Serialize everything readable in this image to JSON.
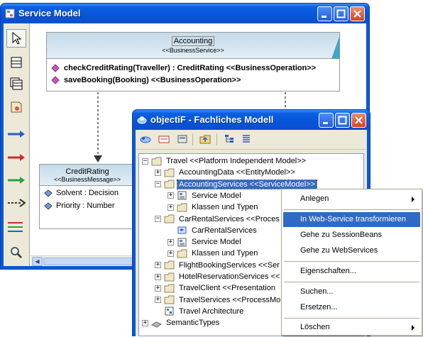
{
  "service_window": {
    "title": "Service Model",
    "palette_tools": [
      "select-tool",
      "class-tool",
      "package-tool",
      "note-tool",
      "association-tool",
      "dependency-tool",
      "realization-tool",
      "flow-tool",
      "composite-tool",
      "zoom-tool"
    ],
    "accounting_box": {
      "name": "Accounting",
      "stereotype": "<<BusinessService>>",
      "operations": [
        "checkCreditRating(Traveller) : CreditRating <<BusinessOperation>>",
        "saveBooking(Booking) <<BusinessOperation>>"
      ]
    },
    "credit_box": {
      "name": "CreditRating",
      "stereotype": "<<BusinessMessage>>",
      "attributes": [
        "Solvent : Decision",
        "Priority : Number"
      ]
    }
  },
  "objectif_window": {
    "title": "objectiF - Fachliches Modell",
    "toolbar_icons": [
      "browse-icon",
      "card-icon",
      "drive-icon",
      "folder-up-icon",
      "hierarchy-icon",
      "list-icon"
    ],
    "tree": [
      {
        "label": "Travel <<Platform Independent Model>>",
        "expander": "−"
      },
      {
        "label": "AccountingData <<EntityModel>>",
        "expander": "+"
      },
      {
        "label": "AccountingServices <<ServiceModel>>",
        "expander": "−"
      },
      {
        "label": "Service Model",
        "expander": "+"
      },
      {
        "label": "Klassen und Typen",
        "expander": "+"
      },
      {
        "label": "CarRentalServices <<Proces",
        "expander": "−"
      },
      {
        "label": "CarRentalServices",
        "expander": ""
      },
      {
        "label": "Service Model",
        "expander": "+"
      },
      {
        "label": "Klassen und Typen",
        "expander": "+"
      },
      {
        "label": "FlightBookingServices <<Ser",
        "expander": "+"
      },
      {
        "label": "HotelReservationServices <<",
        "expander": "+"
      },
      {
        "label": "TravelClient <<Presentation",
        "expander": "+"
      },
      {
        "label": "TravelServices <<ProcessMo",
        "expander": "+"
      },
      {
        "label": "Travel Architecture",
        "expander": ""
      },
      {
        "label": "SemanticTypes",
        "expander": "+"
      }
    ]
  },
  "context_menu": {
    "items": [
      {
        "label": "Anlegen",
        "submenu": true
      },
      {
        "label": "In Web-Service transformieren",
        "highlighted": true
      },
      {
        "label": "Gehe zu SessionBeans"
      },
      {
        "label": "Gehe zu WebServices"
      },
      {
        "label": "Eigenschaften..."
      },
      {
        "label": "Suchen..."
      },
      {
        "label": "Ersetzen..."
      },
      {
        "label": "Löschen",
        "submenu": true
      }
    ]
  },
  "colors": {
    "xp_blue": "#0a58d8",
    "selection": "#316ac5",
    "operation_diamond": "#c85ab8"
  }
}
